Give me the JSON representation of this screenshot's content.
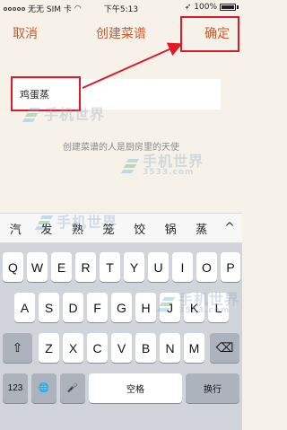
{
  "status_bar": {
    "carrier": "无无 SIM 卡",
    "time": "下午5:13",
    "battery": "100%"
  },
  "nav": {
    "cancel": "取消",
    "title": "创建菜谱",
    "confirm": "确定"
  },
  "form": {
    "recipe_name": "鸡蛋蒸",
    "hint": "创建菜谱的人是厨房里的天使"
  },
  "watermark": {
    "name": "手机世界",
    "url": "3533.com"
  },
  "candidates": [
    "汽",
    "发",
    "熟",
    "笼",
    "饺",
    "锅",
    "蒸"
  ],
  "candidates_toggle": "^",
  "keyboard": {
    "row1": [
      "Q",
      "W",
      "E",
      "R",
      "T",
      "Y",
      "U",
      "I",
      "O",
      "P"
    ],
    "row2": [
      "A",
      "S",
      "D",
      "F",
      "G",
      "H",
      "J",
      "K",
      "L"
    ],
    "row3": [
      "Z",
      "X",
      "C",
      "V",
      "B",
      "N",
      "M"
    ],
    "shift": "⇧",
    "delete": "⌫",
    "numbers": "123",
    "globe": "🌐",
    "mic": "🎤",
    "space": "空格",
    "return": "换行"
  },
  "colors": {
    "accent": "#d5582a",
    "highlight": "#e0192a",
    "background": "#f6f2ea"
  }
}
